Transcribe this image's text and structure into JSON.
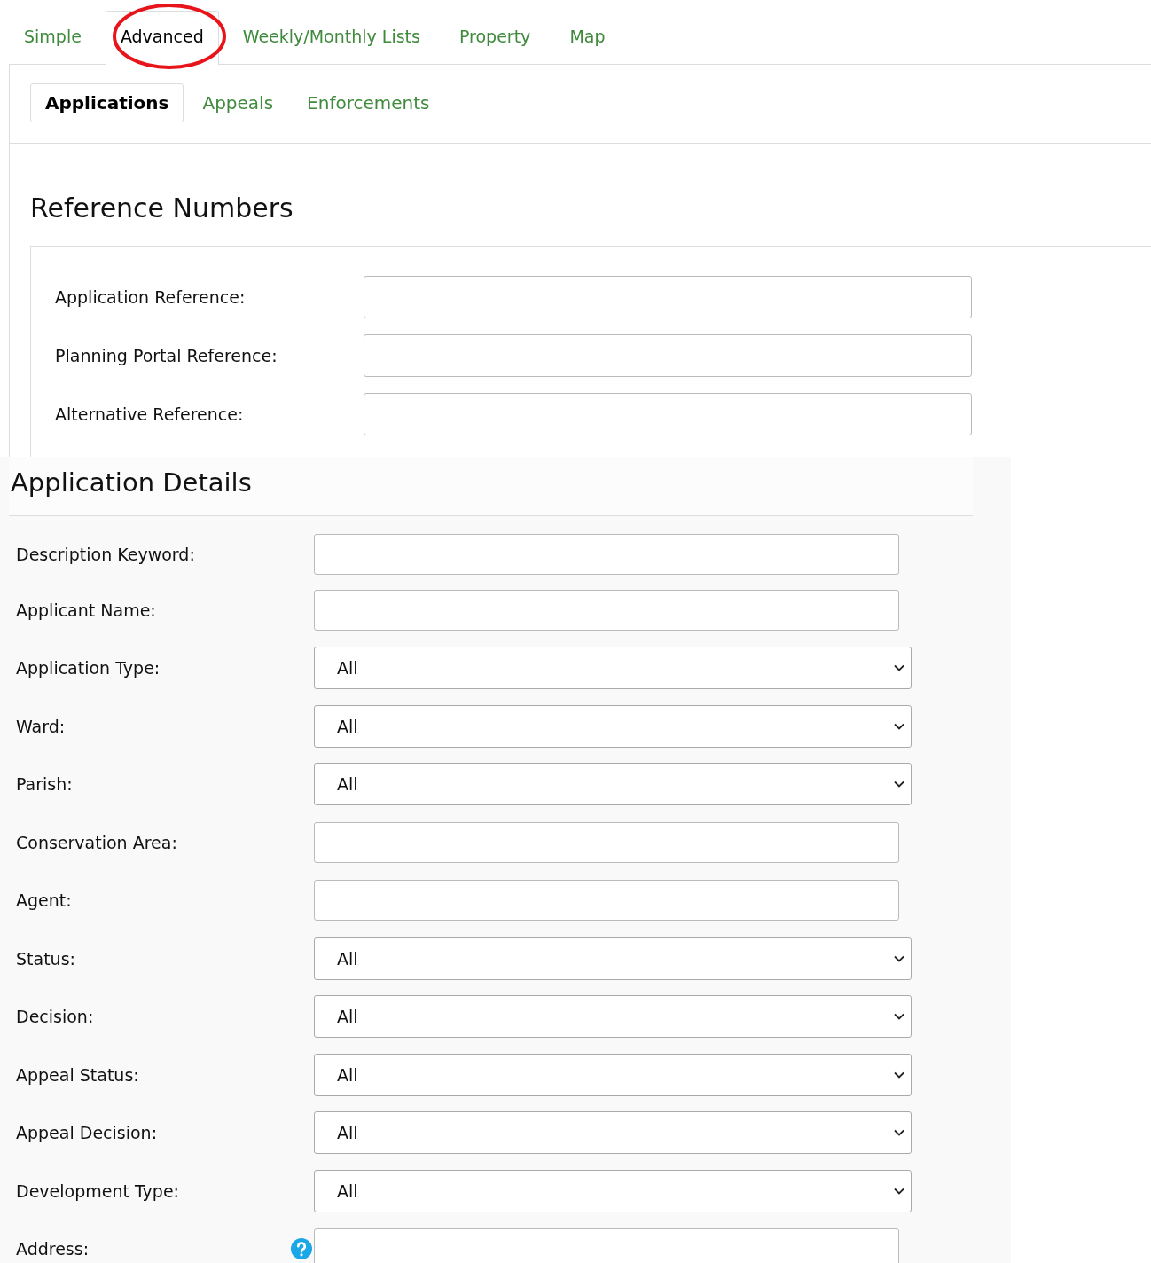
{
  "tabs": [
    {
      "label": "Simple",
      "selected": false,
      "circled": false
    },
    {
      "label": "Advanced",
      "selected": true,
      "circled": true
    },
    {
      "label": "Weekly/Monthly Lists",
      "selected": false,
      "circled": false
    },
    {
      "label": "Property",
      "selected": false,
      "circled": false
    },
    {
      "label": "Map",
      "selected": false,
      "circled": false
    }
  ],
  "subtabs": [
    {
      "label": "Applications",
      "selected": true
    },
    {
      "label": "Appeals",
      "selected": false
    },
    {
      "label": "Enforcements",
      "selected": false
    }
  ],
  "reference_numbers": {
    "title": "Reference Numbers",
    "fields": [
      {
        "label": "Application Reference:"
      },
      {
        "label": "Planning Portal Reference:"
      },
      {
        "label": "Alternative Reference:"
      }
    ]
  },
  "application_details": {
    "title": "Application Details",
    "fields": [
      {
        "label": "Description Keyword:",
        "kind": "text"
      },
      {
        "label": "Applicant Name:",
        "kind": "text"
      },
      {
        "label": "Application Type:",
        "kind": "select",
        "value": "All"
      },
      {
        "label": "Ward:",
        "kind": "select",
        "value": "All"
      },
      {
        "label": "Parish:",
        "kind": "select",
        "value": "All"
      },
      {
        "label": "Conservation Area:",
        "kind": "text"
      },
      {
        "label": "Agent:",
        "kind": "text"
      },
      {
        "label": "Status:",
        "kind": "select",
        "value": "All"
      },
      {
        "label": "Decision:",
        "kind": "select",
        "value": "All"
      },
      {
        "label": "Appeal Status:",
        "kind": "select",
        "value": "All"
      },
      {
        "label": "Appeal Decision:",
        "kind": "select",
        "value": "All"
      },
      {
        "label": "Development Type:",
        "kind": "select",
        "value": "All"
      },
      {
        "label": "Address:",
        "kind": "text",
        "help": true
      }
    ]
  }
}
